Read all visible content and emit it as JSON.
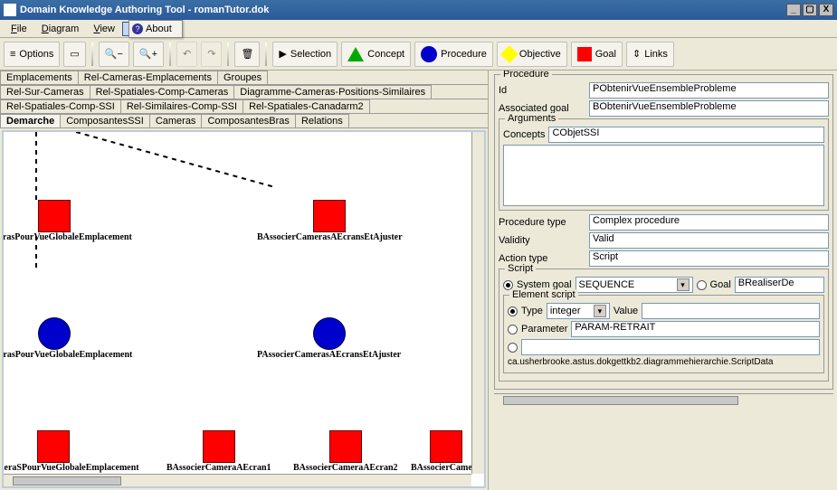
{
  "window": {
    "title": "Domain Knowledge Authoring Tool   -   romanTutor.dok"
  },
  "menu": {
    "file": "File",
    "diagram": "Diagram",
    "view": "View",
    "help": "Help"
  },
  "about": {
    "label": "About"
  },
  "toolbar": {
    "options": "Options",
    "selection": "Selection",
    "concept": "Concept",
    "procedure": "Procedure",
    "objective": "Objective",
    "goal": "Goal",
    "links": "Links"
  },
  "tabs": {
    "row1": [
      "Emplacements",
      "Rel-Cameras-Emplacements",
      "Groupes"
    ],
    "row2": [
      "Rel-Sur-Cameras",
      "Rel-Spatiales-Comp-Cameras",
      "Diagramme-Cameras-Positions-Similaires"
    ],
    "row3": [
      "Rel-Spatiales-Comp-SSI",
      "Rel-Similaires-Comp-SSI",
      "Rel-Spatiales-Canadarm2"
    ],
    "row4": [
      "Demarche",
      "ComposantesSSI",
      "Cameras",
      "ComposantesBras",
      "Relations"
    ],
    "selected": "Demarche"
  },
  "nodes": {
    "a": "sCamerasPourVueGlobaleEmplacement",
    "b": "BAssocierCamerasAEcransEtAjuster",
    "c": "rCamerasPourVueGlobaleEmplacement",
    "d": "PAssocierCamerasAEcransEtAjuster",
    "e": "uperCameraSPourVueGlobaleEmplacement",
    "f": "BAssocierCameraAEcran1",
    "g": "BAssocierCameraAEcran2",
    "h": "BAssocierCamera"
  },
  "panel": {
    "procedure_legend": "Procedure",
    "id_label": "Id",
    "id_value": "PObtenirVueEnsembleProbleme",
    "assoc_goal_label": "Associated goal",
    "assoc_goal_value": "BObtenirVueEnsembleProbleme",
    "arguments_legend": "Arguments",
    "concepts_label": "Concepts",
    "concepts_value": "CObjetSSI",
    "proc_type_label": "Procedure type",
    "proc_type_value": "Complex procedure",
    "validity_label": "Validity",
    "validity_value": "Valid",
    "action_type_label": "Action type",
    "action_type_value": "Script",
    "script_legend": "Script",
    "system_goal_label": "System goal",
    "system_goal_value": "SEQUENCE",
    "goal_label": "Goal",
    "goal_value": "BRealiserDe",
    "element_legend": "Element script",
    "type_label": "Type",
    "type_value": "integer",
    "value_label": "Value",
    "parameter_label": "Parameter",
    "parameter_value": "PARAM-RETRAIT",
    "class_value": "ca.usherbrooke.astus.dokgettkb2.diagrammehierarchie.ScriptData"
  }
}
